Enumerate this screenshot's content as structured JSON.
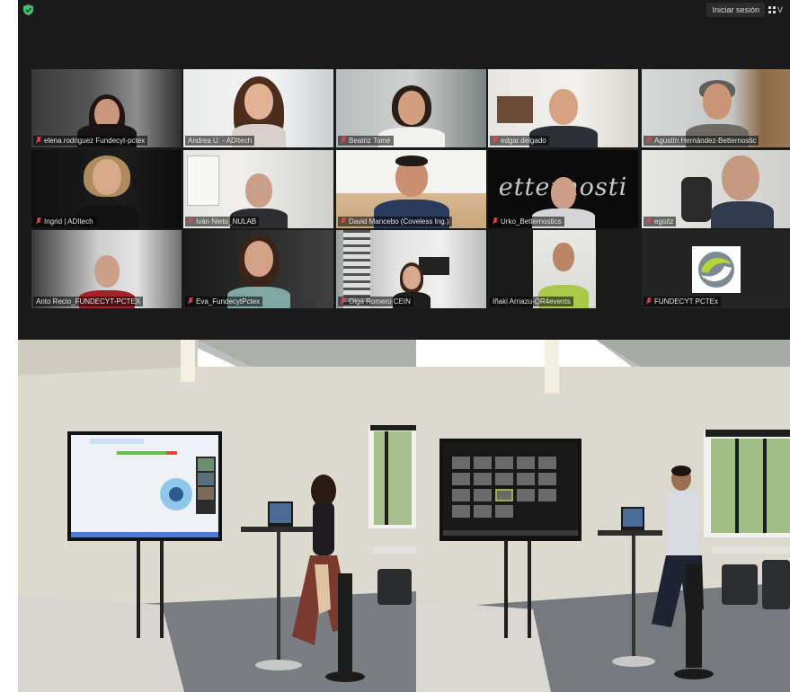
{
  "topbar": {
    "signin_label": "Iniciar sesión",
    "view_label": "V"
  },
  "participants": [
    {
      "name": "elena.rodriguez Fundecyt-pctex",
      "muted": true
    },
    {
      "name": "Andrea U. - ADItech",
      "muted": false
    },
    {
      "name": "Beatriz Tomé",
      "muted": true
    },
    {
      "name": "edgar.delgado",
      "muted": true
    },
    {
      "name": "Agustín Hernández-Betternostic",
      "muted": true
    },
    {
      "name": "Ingrid | ADItech",
      "muted": true
    },
    {
      "name": "Iván Nieto_NULAB",
      "muted": true
    },
    {
      "name": "David Mancebo (Coveless Ing.)",
      "muted": true
    },
    {
      "name": "Urko_Betternostics",
      "muted": true
    },
    {
      "name": "egoitz",
      "muted": true
    },
    {
      "name": "Anto Recio_FUNDECYT-PCTEX",
      "muted": false,
      "active": true
    },
    {
      "name": "Eva_FundecytPctex",
      "muted": true
    },
    {
      "name": "Olga Romero CEIN",
      "muted": true
    },
    {
      "name": "Iñaki Arriazu-QR4events",
      "muted": false
    },
    {
      "name": "FUNDECYT PCTEx",
      "muted": true
    }
  ],
  "tile_texts": {
    "betternostics_wordmark": "etternosti"
  },
  "colors": {
    "meeting_bg": "#1a1a1a",
    "active_speaker_border": "#d6e14a",
    "muted_icon": "#e5484d",
    "shield": "#3ec46d"
  }
}
